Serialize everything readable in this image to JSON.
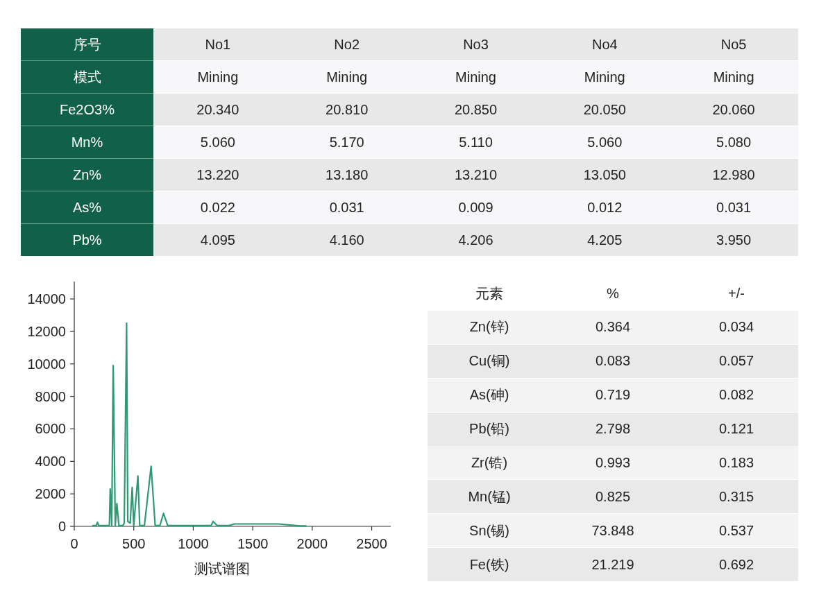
{
  "summary_table": {
    "rows": [
      {
        "label": "序号",
        "cells": [
          "No1",
          "No2",
          "No3",
          "No4",
          "No5"
        ]
      },
      {
        "label": "模式",
        "cells": [
          "Mining",
          "Mining",
          "Mining",
          "Mining",
          "Mining"
        ]
      },
      {
        "label": "Fe2O3%",
        "cells": [
          "20.340",
          "20.810",
          "20.850",
          "20.050",
          "20.060"
        ]
      },
      {
        "label": "Mn%",
        "cells": [
          "5.060",
          "5.170",
          "5.110",
          "5.060",
          "5.080"
        ]
      },
      {
        "label": "Zn%",
        "cells": [
          "13.220",
          "13.180",
          "13.210",
          "13.050",
          "12.980"
        ]
      },
      {
        "label": "As%",
        "cells": [
          "0.022",
          "0.031",
          "0.009",
          "0.012",
          "0.031"
        ]
      },
      {
        "label": "Pb%",
        "cells": [
          "4.095",
          "4.160",
          "4.206",
          "4.205",
          "3.950"
        ]
      }
    ]
  },
  "spectrum": {
    "chart_data": {
      "type": "line",
      "xlabel": "测试谱图",
      "xlim": [
        0,
        2660
      ],
      "ylim": [
        0,
        15070
      ],
      "xticks": [
        0,
        500,
        1000,
        1500,
        2000,
        2500
      ],
      "yticks": [
        0,
        2000,
        4000,
        6000,
        8000,
        10000,
        12000,
        14000
      ],
      "x": [
        150,
        185,
        195,
        205,
        295,
        302,
        315,
        327,
        345,
        358,
        375,
        410,
        420,
        440,
        450,
        470,
        487,
        500,
        535,
        550,
        590,
        646,
        680,
        720,
        750,
        785,
        1150,
        1167,
        1200,
        1300,
        1348,
        1712,
        1900,
        1952
      ],
      "series": [
        {
          "color": "#2e9a72",
          "values": [
            50,
            50,
            250,
            50,
            50,
            2300,
            50,
            9900,
            50,
            1400,
            50,
            50,
            200,
            12500,
            300,
            200,
            2400,
            50,
            3100,
            50,
            50,
            3700,
            50,
            50,
            800,
            50,
            50,
            300,
            50,
            50,
            150,
            150,
            30,
            30
          ]
        }
      ]
    }
  },
  "element_table": {
    "columns": [
      "元素",
      "%",
      "+/-"
    ],
    "rows": [
      [
        "Zn(锌)",
        "0.364",
        "0.034"
      ],
      [
        "Cu(铜)",
        "0.083",
        "0.057"
      ],
      [
        "As(砷)",
        "0.719",
        "0.082"
      ],
      [
        "Pb(铅)",
        "2.798",
        "0.121"
      ],
      [
        "Zr(锆)",
        "0.993",
        "0.183"
      ],
      [
        "Mn(锰)",
        "0.825",
        "0.315"
      ],
      [
        "Sn(锡)",
        "73.848",
        "0.537"
      ],
      [
        "Fe(铁)",
        "21.219",
        "0.692"
      ]
    ]
  }
}
